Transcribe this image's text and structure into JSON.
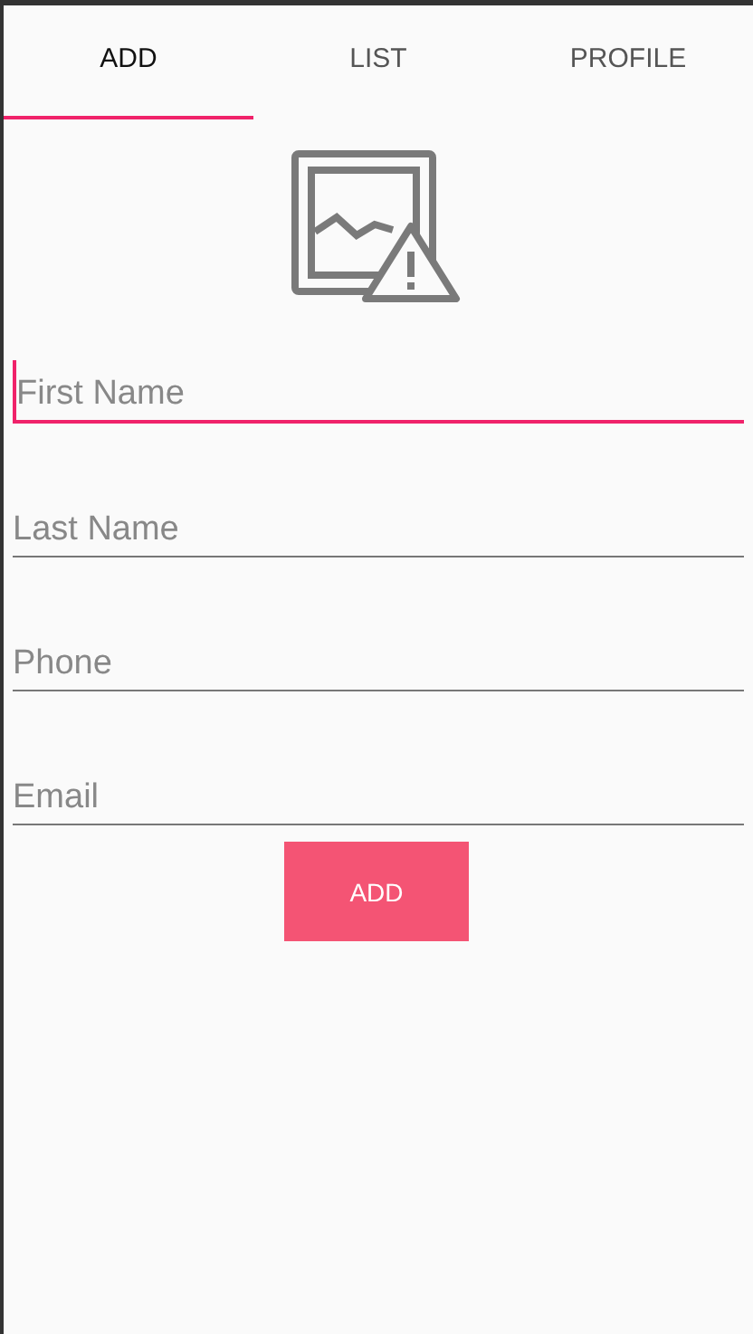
{
  "tabs": [
    {
      "label": "ADD",
      "selected": true
    },
    {
      "label": "LIST",
      "selected": false
    },
    {
      "label": "PROFILE",
      "selected": false
    }
  ],
  "fields": [
    {
      "placeholder": "First Name",
      "focused": true
    },
    {
      "placeholder": "Last Name",
      "focused": false
    },
    {
      "placeholder": "Phone",
      "focused": false
    },
    {
      "placeholder": "Email",
      "focused": false
    }
  ],
  "button": {
    "label": "ADD"
  }
}
